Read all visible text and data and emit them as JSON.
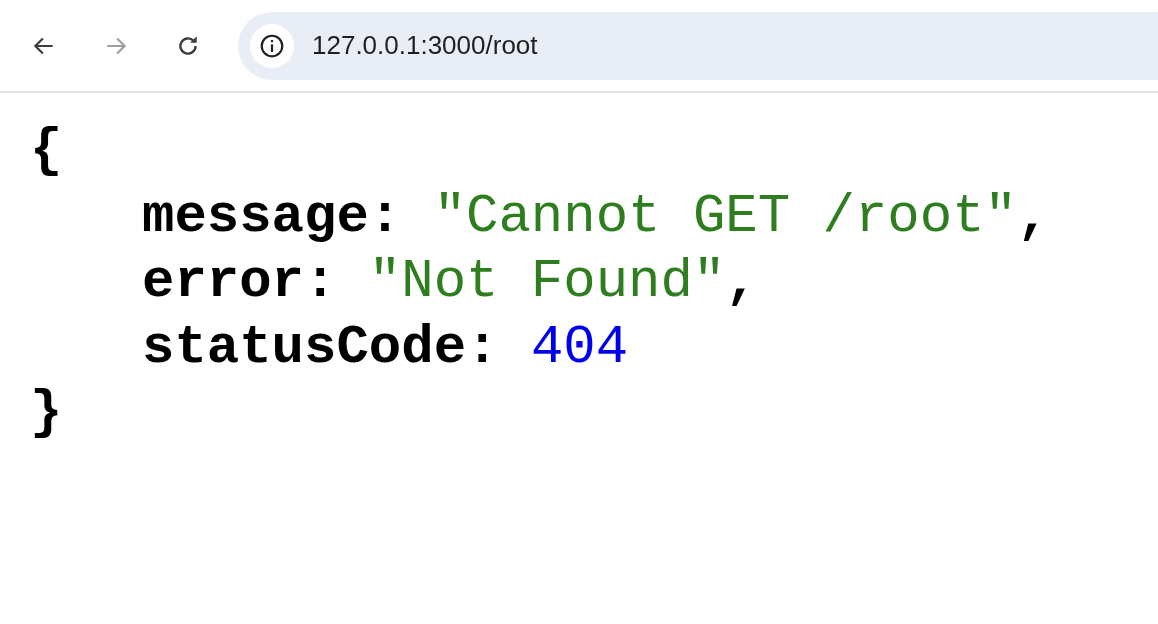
{
  "toolbar": {
    "back": {
      "disabled": false
    },
    "forward": {
      "disabled": true
    },
    "reload": {
      "disabled": false
    },
    "url": "127.0.0.1:3000/root"
  },
  "json_view": {
    "open": "{",
    "close": "}",
    "entries": [
      {
        "key": "message:",
        "kind": "string",
        "value": "\"Cannot GET /root\"",
        "comma": ","
      },
      {
        "key": "error:",
        "kind": "string",
        "value": "\"Not Found\"",
        "comma": ","
      },
      {
        "key": "statusCode:",
        "kind": "number",
        "value": "404"
      }
    ]
  }
}
